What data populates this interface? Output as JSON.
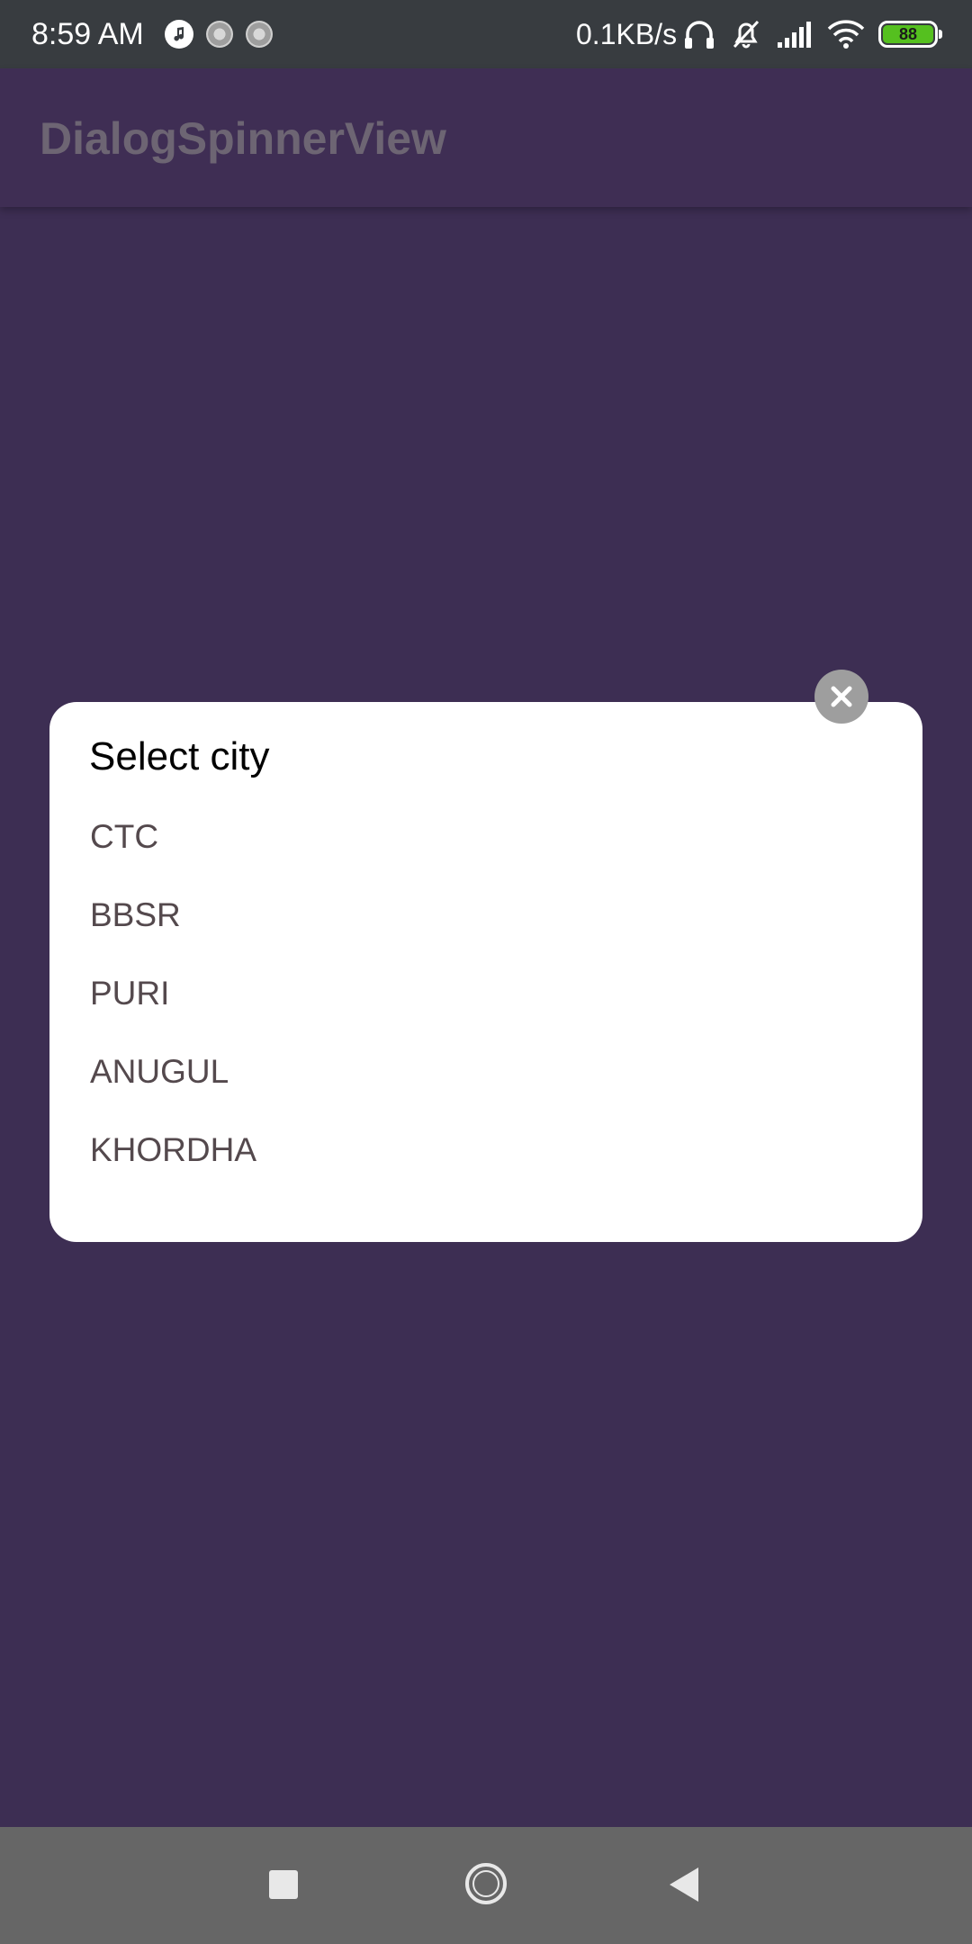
{
  "status_bar": {
    "time": "8:59 AM",
    "speed": "0.1KB/s",
    "battery": "88",
    "icons": [
      "music-icon",
      "loading-icon",
      "loading-icon",
      "headphones-icon",
      "mute-icon",
      "signal-icon",
      "wifi-icon",
      "battery-icon"
    ]
  },
  "app_bar": {
    "title": "DialogSpinnerView"
  },
  "dialog": {
    "title": "Select city",
    "items": [
      "CTC",
      "BBSR",
      "PURI",
      "ANUGUL",
      "KHORDHA"
    ]
  },
  "nav_bar": {
    "icons": [
      "recents-icon",
      "home-icon",
      "back-icon"
    ]
  },
  "colors": {
    "background": "#3d2e53",
    "status_bar": "#383c40",
    "nav_bar": "#666666",
    "dialog": "#ffffff",
    "close_button": "#9e9e9e",
    "battery_fill": "#55c01f"
  }
}
